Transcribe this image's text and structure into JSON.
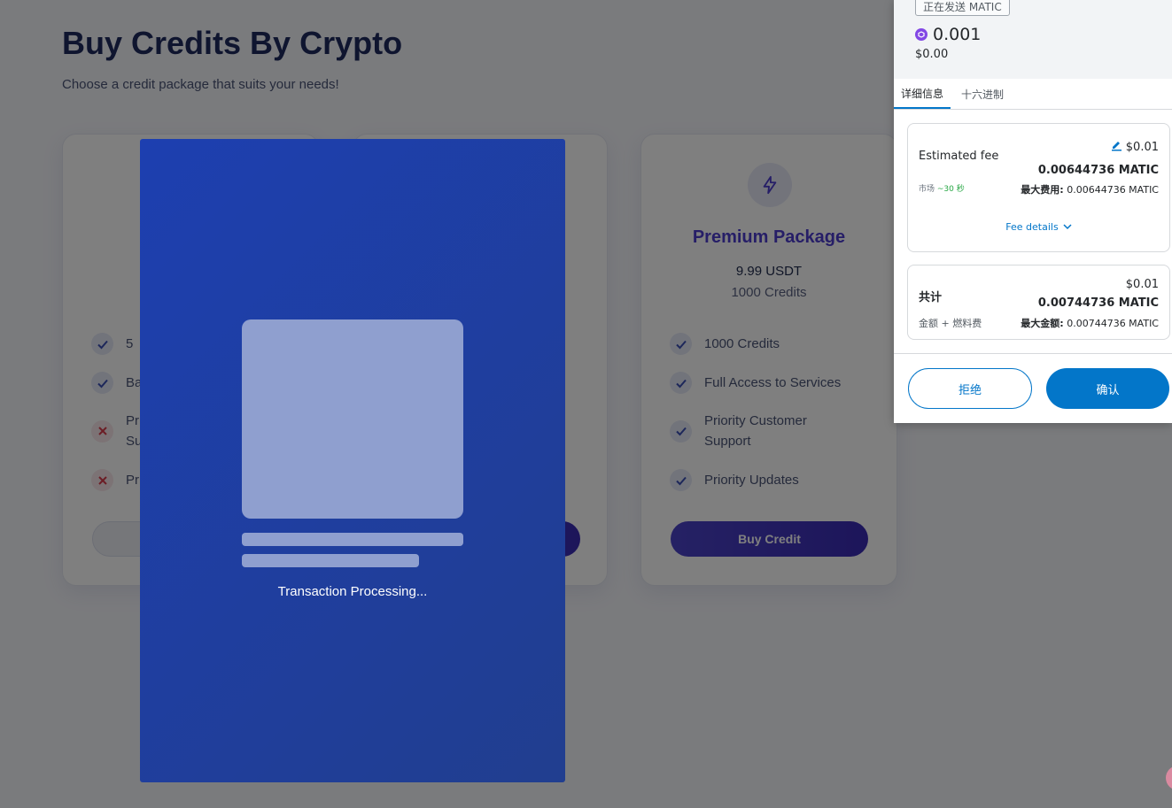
{
  "page": {
    "title": "Buy Credits By Crypto",
    "subtitle": "Choose a credit package that suits your needs!"
  },
  "cards": [
    {
      "features": [
        {
          "label": "5",
          "included": true
        },
        {
          "label": "Ba",
          "included": true
        },
        {
          "label": "Pr\nSu",
          "included": false
        },
        {
          "label": "Pr",
          "included": false
        }
      ]
    },
    {},
    {
      "icon": "lightning-icon",
      "name": "Premium Package",
      "price": "9.99 USDT",
      "credits": "1000 Credits",
      "features": [
        {
          "label": "1000 Credits",
          "included": true
        },
        {
          "label": "Full Access to Services",
          "included": true
        },
        {
          "label": "Priority Customer Support",
          "included": true
        },
        {
          "label": "Priority Updates",
          "included": true
        }
      ],
      "button": "Buy Credit"
    }
  ],
  "processing": {
    "text": "Transaction Processing..."
  },
  "wallet": {
    "send_badge": "正在发送 MATIC",
    "amount": "0.001",
    "amount_usd": "$0.00",
    "tabs": [
      "详细信息",
      "十六进制"
    ],
    "fee": {
      "label": "Estimated fee",
      "usd": "$0.01",
      "amount": "0.00644736 MATIC",
      "market": "市场",
      "market_time": "~30 秒",
      "max_label": "最大费用:",
      "max_value": "0.00644736 MATIC",
      "details_link": "Fee details"
    },
    "total": {
      "label": "共计",
      "usd": "$0.01",
      "amount": "0.00744736 MATIC",
      "sub": "金额 + 燃料费",
      "max_label": "最大金额:",
      "max_value": "0.00744736 MATIC"
    },
    "reject_label": "拒绝",
    "confirm_label": "确认"
  },
  "colors": {
    "brand_purple": "#4c3ccf",
    "processing_blue": "#1d3fb0",
    "wallet_blue": "#0376c9",
    "matic_purple": "#8247e5",
    "check_blue": "#3a4fb5",
    "cross_red": "#d93a4a"
  }
}
